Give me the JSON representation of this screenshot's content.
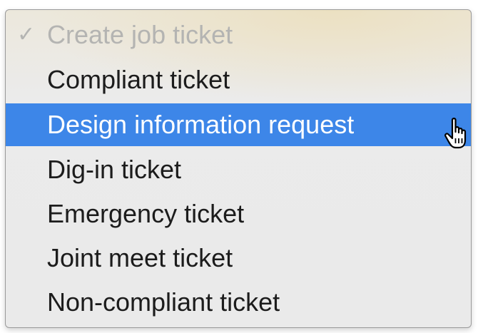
{
  "menu": {
    "items": [
      {
        "label": "Create job ticket",
        "checked": true,
        "disabled": true
      },
      {
        "label": "Compliant ticket"
      },
      {
        "label": "Design information request",
        "highlighted": true
      },
      {
        "label": "Dig-in ticket"
      },
      {
        "label": "Emergency ticket"
      },
      {
        "label": "Joint meet ticket"
      },
      {
        "label": "Non-compliant ticket"
      }
    ],
    "checkmark": "✓"
  },
  "icons": {
    "cursor": "pointing-hand-cursor-icon"
  },
  "colors": {
    "highlight": "#3d86e8",
    "text": "#1c1c1c",
    "disabled_text": "#b4b4b2"
  }
}
